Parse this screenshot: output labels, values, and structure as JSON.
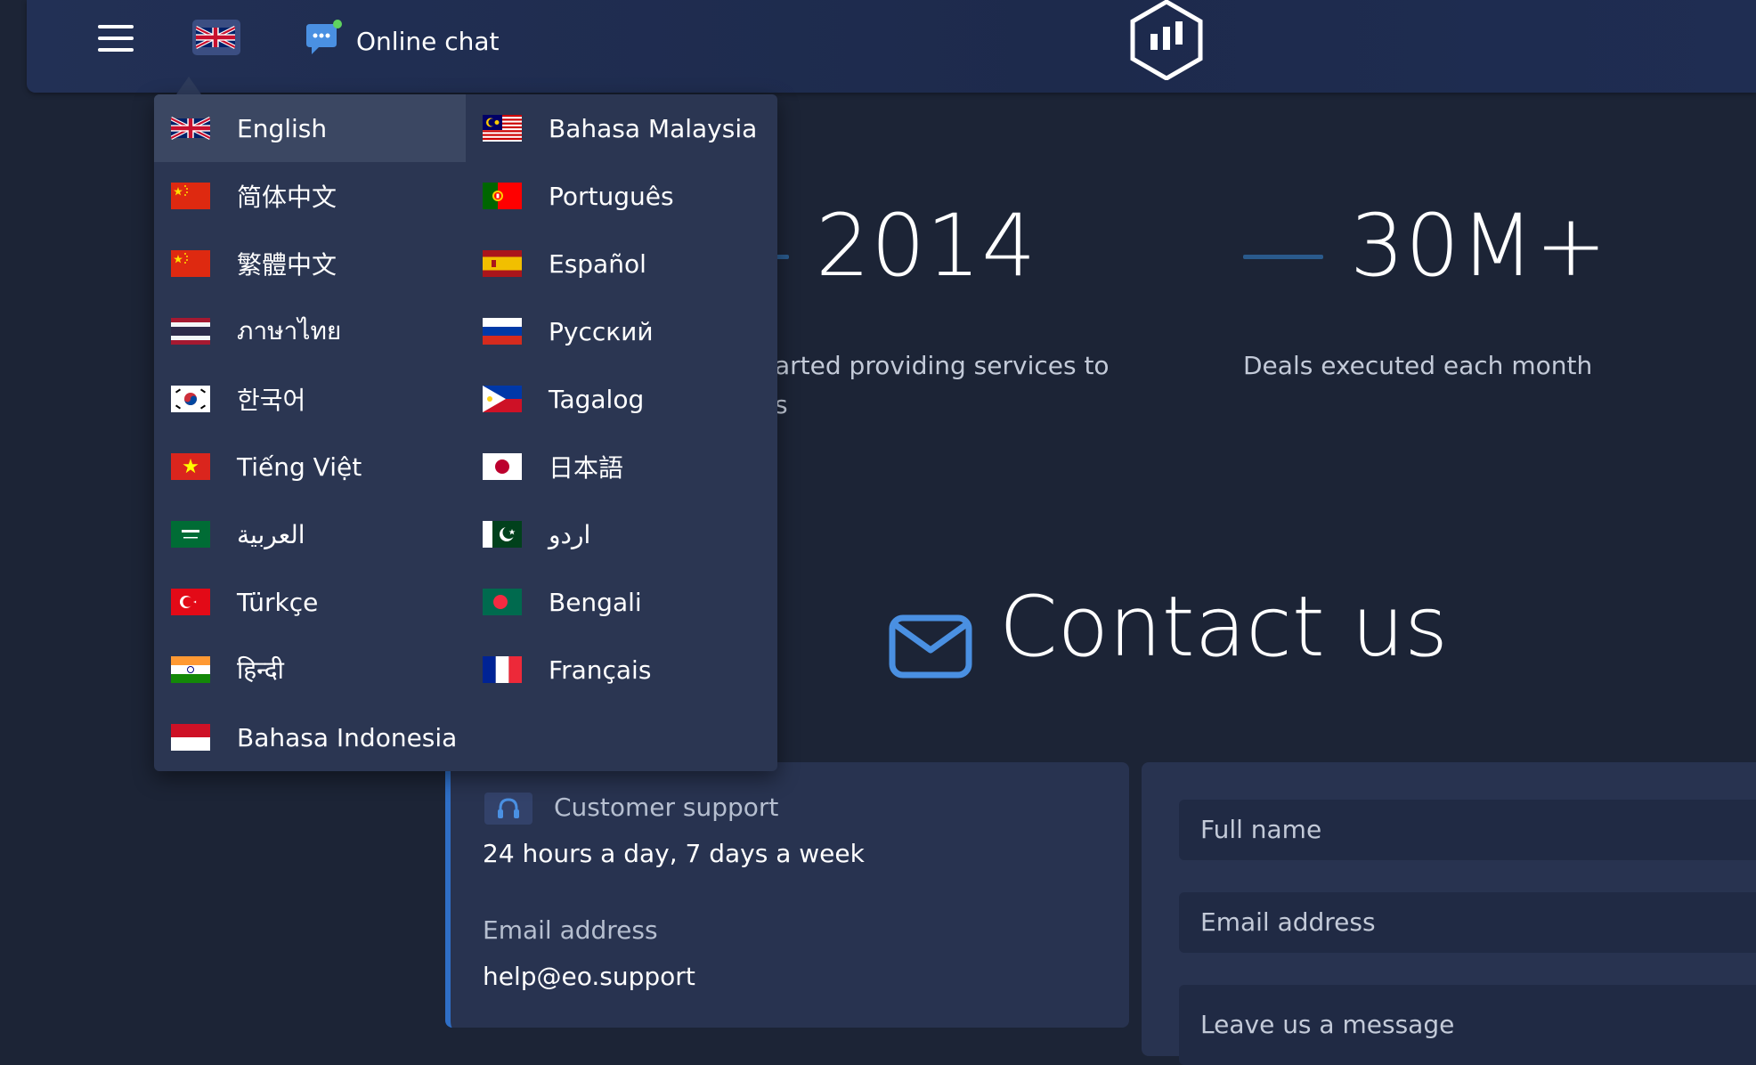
{
  "header": {
    "menu_icon": "hamburger-icon",
    "language_icon": "uk-flag-icon",
    "chat_icon": "chat-bubble-icon",
    "chat_label": "Online chat",
    "logo_icon": "hexagon-bars-logo"
  },
  "language_menu": {
    "left_column": [
      {
        "label": "English",
        "flag": "uk",
        "active": true
      },
      {
        "label": "简体中文",
        "flag": "cn"
      },
      {
        "label": "繁體中文",
        "flag": "cn"
      },
      {
        "label": "ภาษาไทย",
        "flag": "th"
      },
      {
        "label": "한국어",
        "flag": "kr"
      },
      {
        "label": "Tiếng Việt",
        "flag": "vn"
      },
      {
        "label": "العربية",
        "flag": "sa"
      },
      {
        "label": "Türkçe",
        "flag": "tr"
      },
      {
        "label": "हिन्दी",
        "flag": "in"
      },
      {
        "label": "Bahasa Indonesia",
        "flag": "id"
      }
    ],
    "right_column": [
      {
        "label": "Bahasa Malaysia",
        "flag": "my"
      },
      {
        "label": "Português",
        "flag": "pt"
      },
      {
        "label": "Español",
        "flag": "es"
      },
      {
        "label": "Русский",
        "flag": "ru"
      },
      {
        "label": "Tagalog",
        "flag": "ph"
      },
      {
        "label": "日本語",
        "flag": "jp"
      },
      {
        "label": "اردو",
        "flag": "pk"
      },
      {
        "label": "Bengali",
        "flag": "bd"
      },
      {
        "label": "Français",
        "flag": "fr"
      }
    ]
  },
  "stats": [
    {
      "value": "2014",
      "description_line1": "arted providing services to",
      "description_line2": "s"
    },
    {
      "value": "30M+",
      "description_line1": "Deals executed each month"
    }
  ],
  "contact": {
    "title": "Contact us",
    "icon": "envelope-icon",
    "support_icon": "headset-icon",
    "support_label": "Customer support",
    "support_hours": "24 hours a day, 7 days a week",
    "email_label": "Email address",
    "email_value": "help@eo.support"
  },
  "form": {
    "full_name_placeholder": "Full name",
    "email_placeholder": "Email address",
    "message_placeholder": "Leave us a message"
  },
  "colors": {
    "background": "#1c2436",
    "header": "#223055",
    "dropdown": "#2b3652",
    "accent": "#2f6fc7",
    "chat_icon": "#4a90e2",
    "chat_dot": "#5fd35f"
  }
}
